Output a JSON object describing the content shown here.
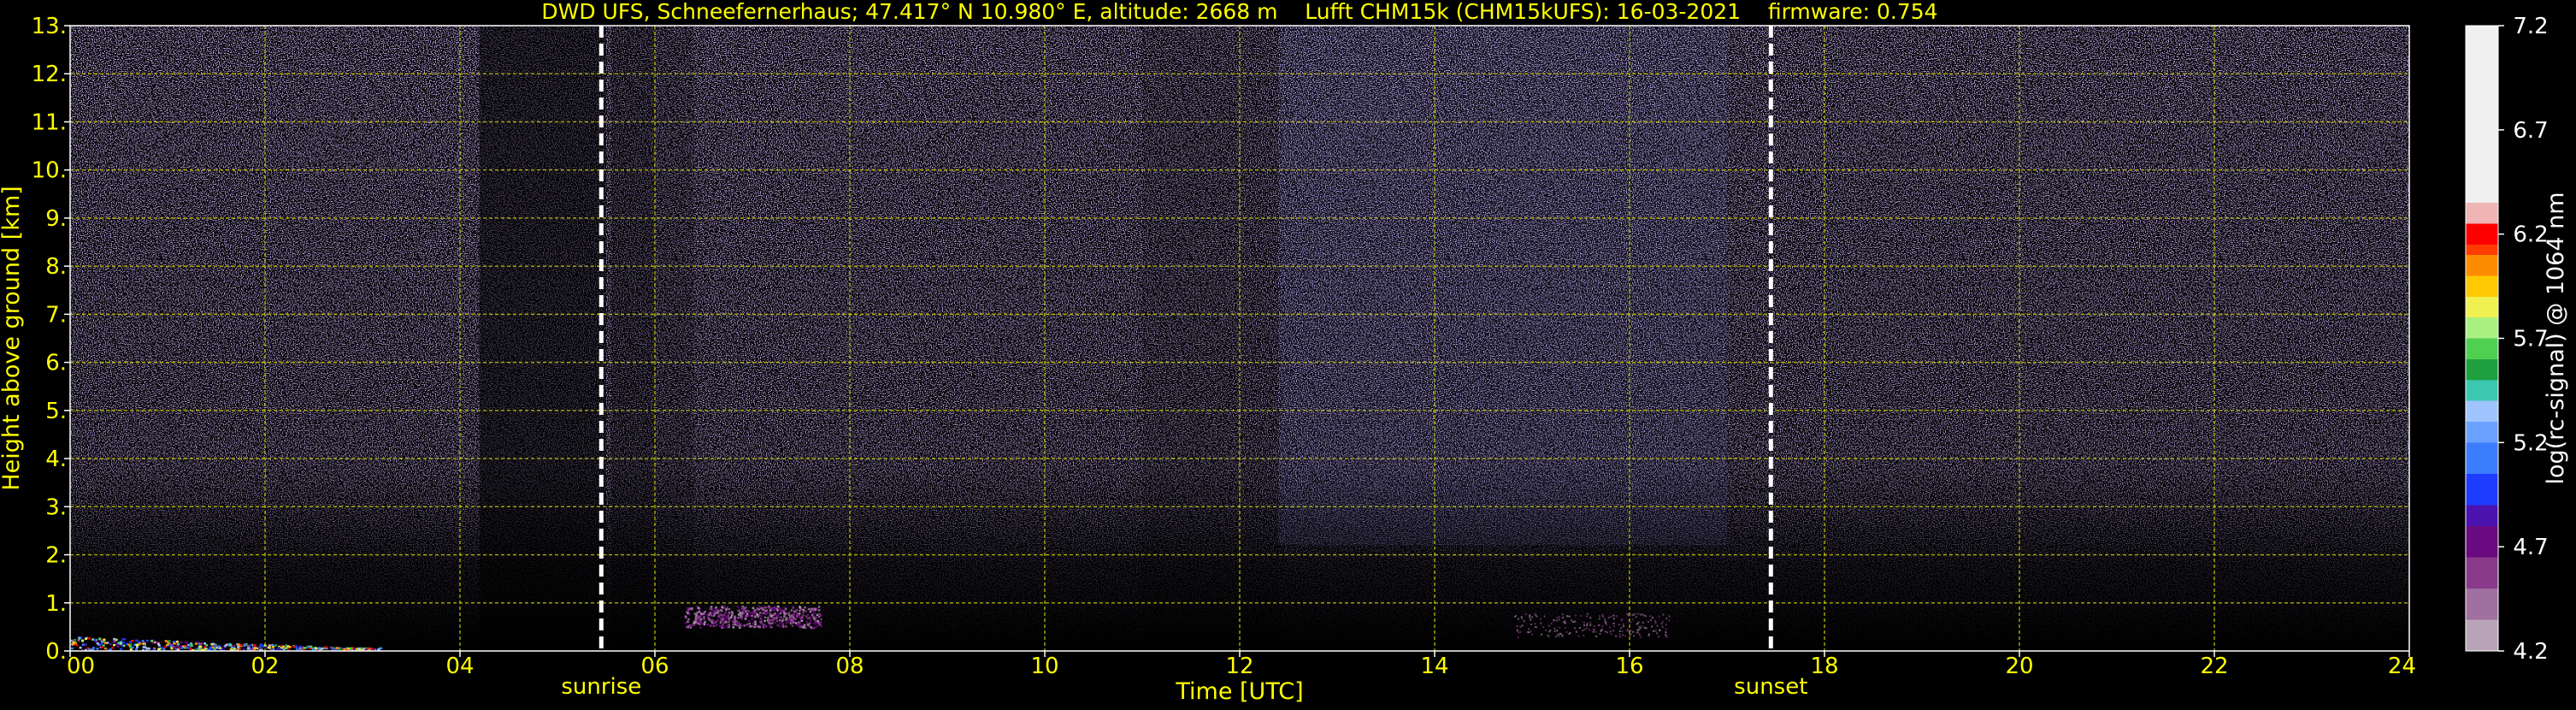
{
  "chart_data": {
    "type": "heatmap",
    "title": "DWD UFS, Schneefernerhaus; 47.417° N 10.980° E, altitude: 2668 m    Lufft CHM15k (CHM15kUFS): 16-03-2021    firmware: 0.754",
    "xlabel": "Time [UTC]",
    "ylabel": "Height above ground [km]",
    "xlim": [
      0,
      24
    ],
    "ylim": [
      0,
      13
    ],
    "x_ticks": [
      {
        "value": 0,
        "label": "00"
      },
      {
        "value": 2,
        "label": "02"
      },
      {
        "value": 4,
        "label": "04"
      },
      {
        "value": 6,
        "label": "06"
      },
      {
        "value": 8,
        "label": "08"
      },
      {
        "value": 10,
        "label": "10"
      },
      {
        "value": 12,
        "label": "12"
      },
      {
        "value": 14,
        "label": "14"
      },
      {
        "value": 16,
        "label": "16"
      },
      {
        "value": 18,
        "label": "18"
      },
      {
        "value": 20,
        "label": "20"
      },
      {
        "value": 22,
        "label": "22"
      },
      {
        "value": 24,
        "label": "24"
      }
    ],
    "y_ticks": [
      {
        "value": 0,
        "label": "0."
      },
      {
        "value": 1,
        "label": "1."
      },
      {
        "value": 2,
        "label": "2."
      },
      {
        "value": 3,
        "label": "3."
      },
      {
        "value": 4,
        "label": "4."
      },
      {
        "value": 5,
        "label": "5."
      },
      {
        "value": 6,
        "label": "6."
      },
      {
        "value": 7,
        "label": "7."
      },
      {
        "value": 8,
        "label": "8."
      },
      {
        "value": 9,
        "label": "9."
      },
      {
        "value": 10,
        "label": "10."
      },
      {
        "value": 11,
        "label": "11."
      },
      {
        "value": 12,
        "label": "12."
      },
      {
        "value": 13,
        "label": "13."
      }
    ],
    "grid": true,
    "event_lines": [
      {
        "value": 5.45,
        "label": "sunrise"
      },
      {
        "value": 17.45,
        "label": "sunset"
      }
    ],
    "colorbar": {
      "label": "log(rc-signal) @ 1064 nm",
      "range": [
        4.2,
        7.2
      ],
      "ticks": [
        {
          "value": 4.2,
          "label": "4.2"
        },
        {
          "value": 4.7,
          "label": "4.7"
        },
        {
          "value": 5.2,
          "label": "5.2"
        },
        {
          "value": 5.7,
          "label": "5.7"
        },
        {
          "value": 6.2,
          "label": "6.2"
        },
        {
          "value": 6.7,
          "label": "6.7"
        },
        {
          "value": 7.2,
          "label": "7.2"
        }
      ],
      "stops": [
        {
          "value": 4.2,
          "color": "#b8a4b8"
        },
        {
          "value": 4.35,
          "color": "#a070a0"
        },
        {
          "value": 4.5,
          "color": "#8a3a8a"
        },
        {
          "value": 4.65,
          "color": "#6a0a80"
        },
        {
          "value": 4.8,
          "color": "#4b12b0"
        },
        {
          "value": 4.9,
          "color": "#1e3cff"
        },
        {
          "value": 5.05,
          "color": "#3c7cff"
        },
        {
          "value": 5.2,
          "color": "#6aa0ff"
        },
        {
          "value": 5.3,
          "color": "#9fc4ff"
        },
        {
          "value": 5.4,
          "color": "#3cc8b0"
        },
        {
          "value": 5.5,
          "color": "#1ea040"
        },
        {
          "value": 5.6,
          "color": "#50d050"
        },
        {
          "value": 5.7,
          "color": "#aaf080"
        },
        {
          "value": 5.8,
          "color": "#f0f050"
        },
        {
          "value": 5.9,
          "color": "#ffc800"
        },
        {
          "value": 6.0,
          "color": "#ff8c00"
        },
        {
          "value": 6.1,
          "color": "#ff3c00"
        },
        {
          "value": 6.15,
          "color": "#ff0000"
        },
        {
          "value": 6.25,
          "color": "#f0b4b4"
        },
        {
          "value": 6.35,
          "color": "#f0f0f0"
        },
        {
          "value": 7.2,
          "color": "#ffffff"
        }
      ]
    },
    "colors": {
      "background": "#000000",
      "text": "#ffff00",
      "grid": "#c8c800",
      "axis": "#ffffff",
      "noise": "#8060c8",
      "event_line": "#ffffff",
      "colorbar_label": "#ffffff"
    }
  }
}
